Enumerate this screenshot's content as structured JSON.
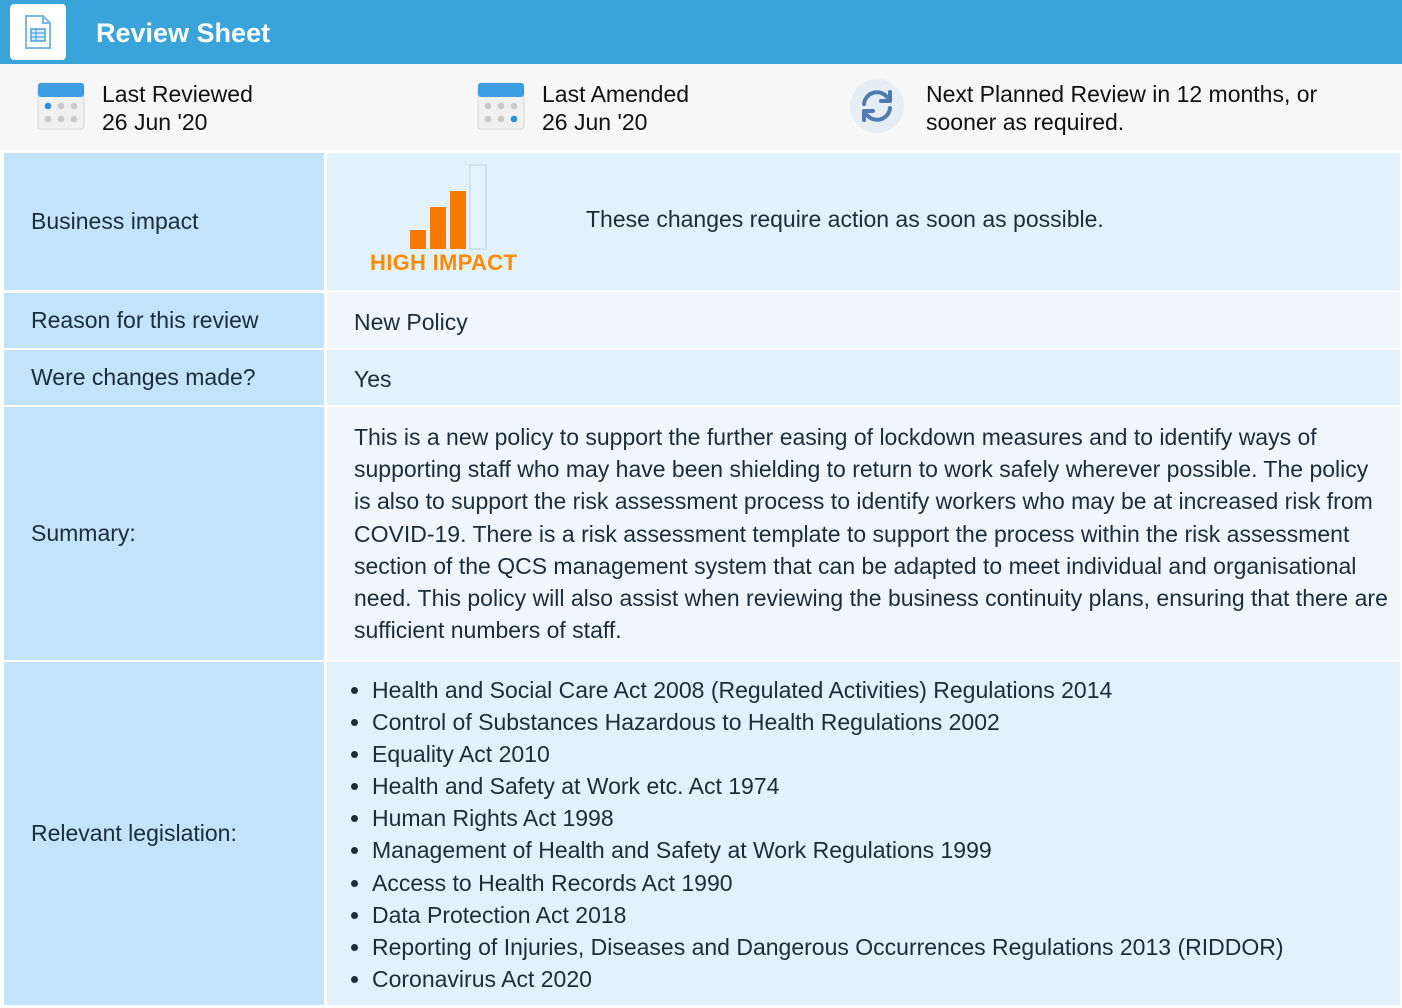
{
  "header": {
    "title": "Review Sheet",
    "icon": "document-icon"
  },
  "meta": {
    "last_reviewed": {
      "label": "Last Reviewed",
      "date": "26 Jun '20",
      "icon": "calendar-icon"
    },
    "last_amended": {
      "label": "Last Amended",
      "date": "26 Jun '20",
      "icon": "calendar-icon"
    },
    "next_review": {
      "line1": "Next Planned Review in 12 months, or",
      "line2": "sooner as required.",
      "icon": "refresh-icon"
    }
  },
  "rows": {
    "business_impact": {
      "label": "Business impact",
      "impact_level": "HIGH IMPACT",
      "impact_bars_filled": 3,
      "impact_bars_total": 4,
      "description": "These changes require action as soon as possible."
    },
    "reason": {
      "label": "Reason for this review",
      "value": "New Policy"
    },
    "changes": {
      "label": "Were changes made?",
      "value": "Yes"
    },
    "summary": {
      "label": "Summary:",
      "value": "This is a new policy to support the further easing of lockdown measures and to identify ways of supporting staff who may have been shielding to return to work safely wherever possible. The policy is also to support the risk assessment process to identify workers who may be at increased risk from COVID-19. There is a risk assessment template to support the process within the risk assessment section of the QCS management system that can be adapted to meet individual and organisational need. This policy will also assist when reviewing the business continuity plans, ensuring that there are sufficient numbers of staff."
    },
    "legislation": {
      "label": "Relevant legislation:",
      "items": [
        "Health and Social Care Act 2008 (Regulated Activities) Regulations 2014",
        "Control of Substances Hazardous to Health Regulations 2002",
        "Equality Act 2010",
        "Health and Safety at Work etc. Act 1974",
        "Human Rights Act 1998",
        "Management of Health and Safety at Work Regulations 1999",
        "Access to Health Records Act 1990",
        "Data Protection Act 2018",
        "Reporting of Injuries, Diseases and Dangerous Occurrences Regulations 2013 (RIDDOR)",
        "Coronavirus Act 2020"
      ]
    }
  },
  "colors": {
    "header": "#3aa3d9",
    "label_bg": "#c2e3fa",
    "value_bg": "#e2f2fc",
    "impact": "#ff8c00"
  }
}
